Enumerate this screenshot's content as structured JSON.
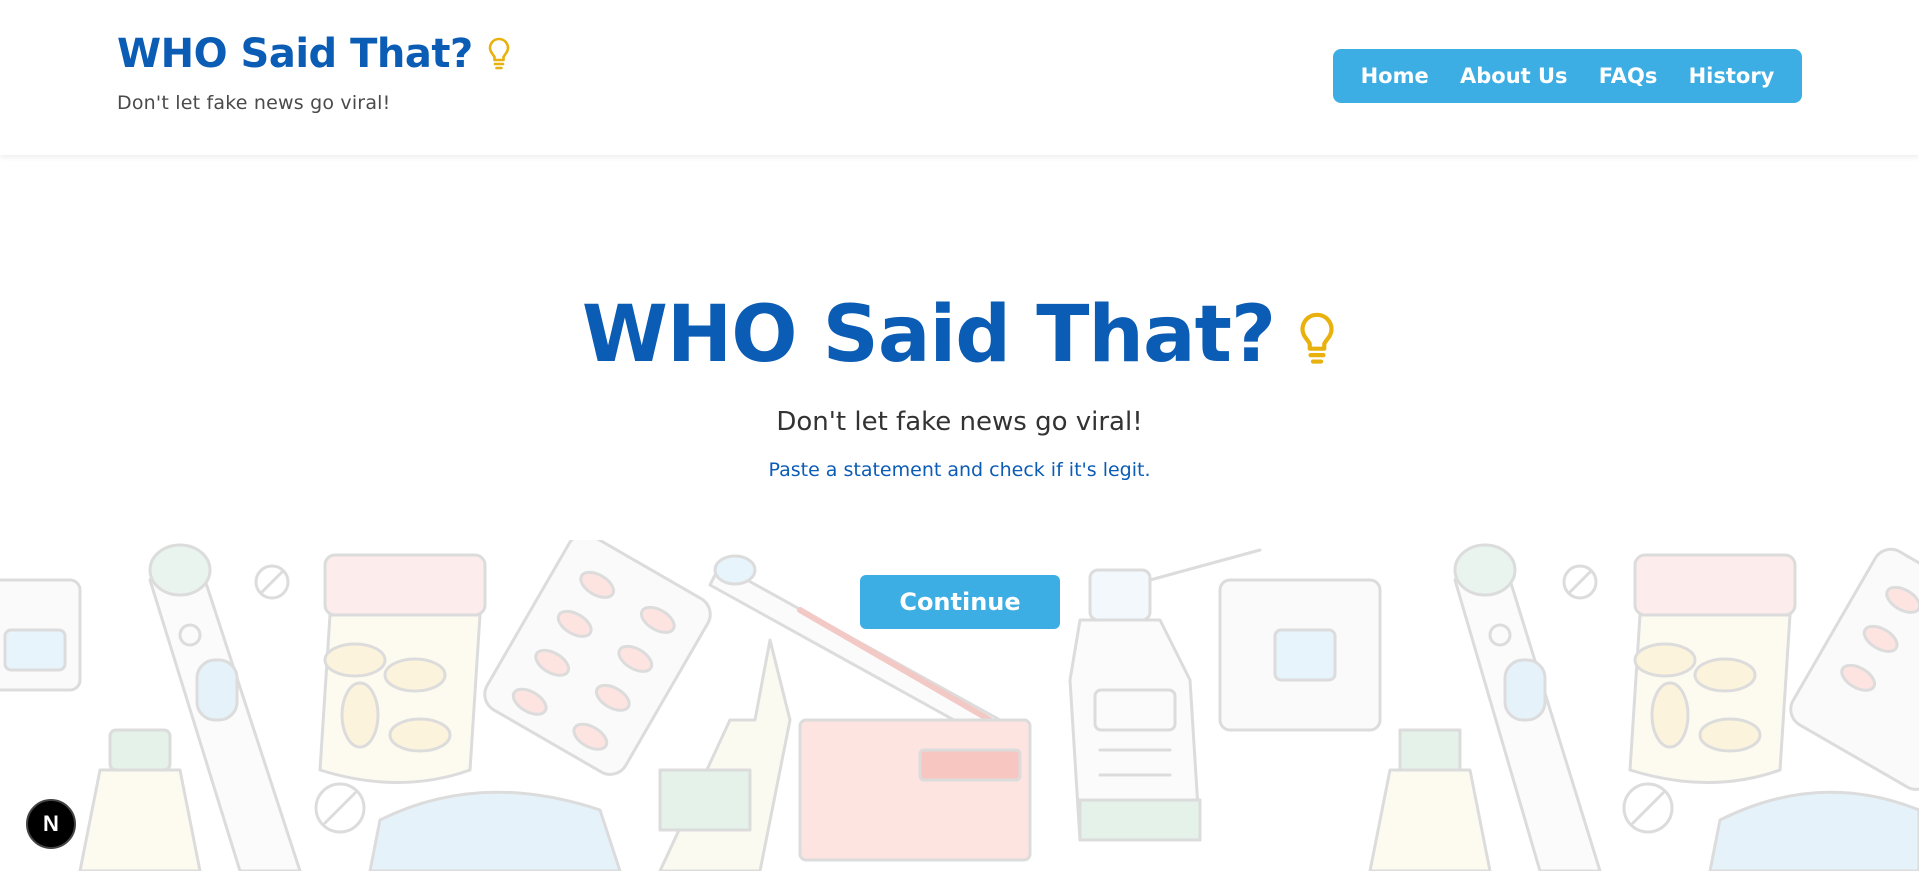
{
  "header": {
    "brand_title": "WHO Said That?",
    "brand_tagline": "Don't let fake news go viral!",
    "nav": [
      {
        "label": "Home"
      },
      {
        "label": "About Us"
      },
      {
        "label": "FAQs"
      },
      {
        "label": "History"
      }
    ]
  },
  "hero": {
    "title": "WHO Said That?",
    "tagline": "Don't let fake news go viral!",
    "instruction": "Paste a statement and check if it's legit.",
    "continue_label": "Continue"
  },
  "badge": {
    "letter": "N"
  },
  "colors": {
    "brand_blue": "#0b5cb5",
    "accent_blue": "#3daee3",
    "bulb_yellow": "#e8b10d"
  },
  "icons": {
    "title_icon": "lightbulb-icon",
    "background": "medical-supplies-pattern"
  }
}
